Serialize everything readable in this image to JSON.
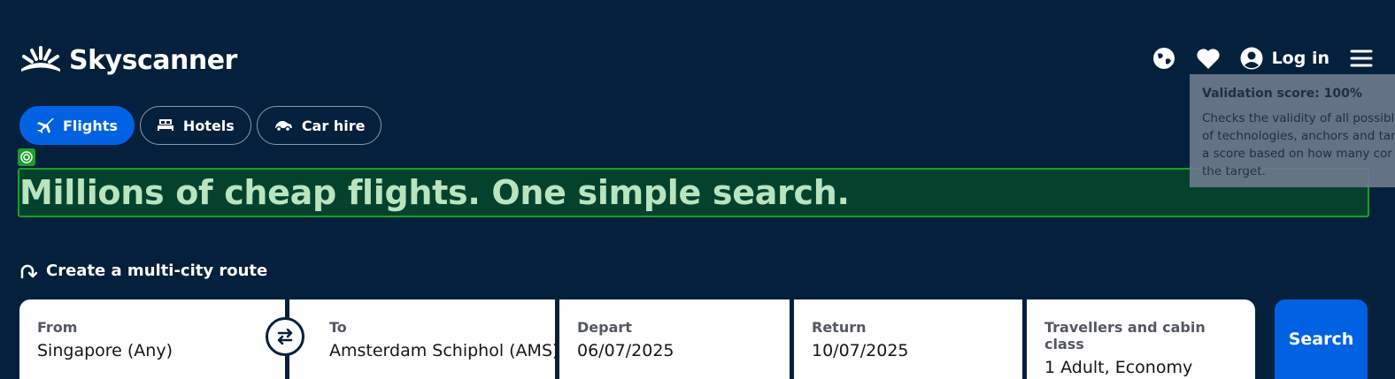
{
  "brand": {
    "name": "Skyscanner"
  },
  "header": {
    "login_label": "Log in"
  },
  "tabs": [
    {
      "label": "Flights",
      "icon": "plane-icon",
      "active": true
    },
    {
      "label": "Hotels",
      "icon": "bed-icon",
      "active": false
    },
    {
      "label": "Car hire",
      "icon": "car-icon",
      "active": false
    }
  ],
  "headline": "Millions of cheap flights. One simple search.",
  "tooltip": {
    "title": "Validation score: 100%",
    "lines": [
      "Checks the validity of all possibl",
      "of technologies, anchors and tar",
      "a score based on how many cor",
      "the target."
    ]
  },
  "multi_city_label": "Create a multi-city route",
  "search": {
    "from_label": "From",
    "from_value": "Singapore (Any)",
    "to_label": "To",
    "to_value": "Amsterdam Schiphol (AMS)",
    "depart_label": "Depart",
    "depart_value": "06/07/2025",
    "return_label": "Return",
    "return_value": "10/07/2025",
    "travellers_label": "Travellers and cabin class",
    "travellers_value": "1 Adult, Economy",
    "button_label": "Search"
  },
  "colors": {
    "background": "#05203c",
    "primary": "#0062e3",
    "validation_green": "#16a025"
  }
}
